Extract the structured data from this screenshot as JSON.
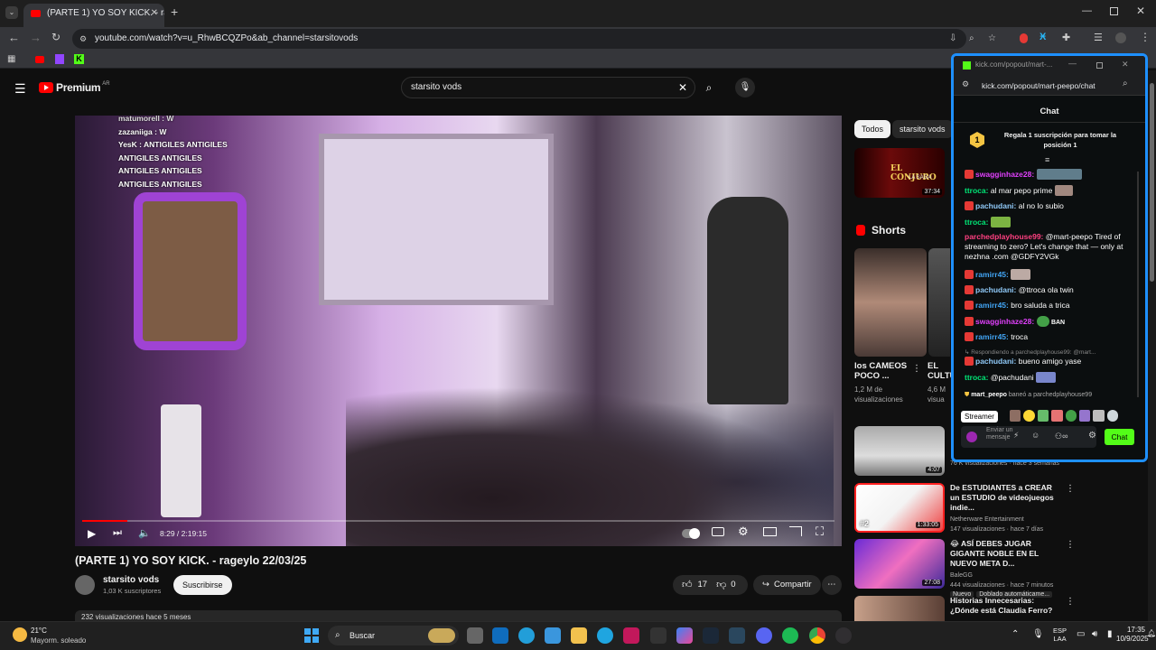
{
  "browser": {
    "tab_title": "(PARTE 1) YO SOY KICK. - rageyl",
    "url": "youtube.com/watch?v=u_RhwBCQZPo&ab_channel=starsitovods"
  },
  "yt": {
    "logo": "Premium",
    "region": "AR",
    "search": "starsito vods",
    "video_title": "(PARTE 1) YO SOY KICK. - rageylo 22/03/25",
    "channel": "starsito vods",
    "subs": "1,03 K suscriptores",
    "subscribe": "Suscribirse",
    "likes": "17",
    "dislikes": "0",
    "share": "Compartir",
    "views_partial": "232 visualizaciones hace 5 meses",
    "time": "8:29 / 2:19:15",
    "chips": [
      "Todos",
      "starsito vods"
    ],
    "shorts": "Shorts",
    "thumb_top_duration": "37:34",
    "thumb_top_label": "EL CONJURO",
    "thumb_top_sub": "LA SAGA"
  },
  "overlay_chat": [
    "matumorell : W",
    "zazaniiga : W",
    "YesK : ANTIGILES ANTIGILES",
    "ANTIGILES ANTIGILES",
    "ANTIGILES ANTIGILES",
    "ANTIGILES ANTIGILES"
  ],
  "shorts_items": [
    {
      "title": "los CAMEOS POCO ...",
      "meta1": "1,2 M de",
      "meta2": "visualizaciones"
    },
    {
      "title": "EL CULTU",
      "meta1": "4,6 M",
      "meta2": "visua"
    }
  ],
  "related": [
    {
      "duration": "4:07",
      "title": "",
      "channel": "",
      "meta": "76 K visualizaciones · hace 3 semanas"
    },
    {
      "duration": "1:33:05",
      "title": "De ESTUDIANTES a CREAR un ESTUDIO de videojuegos indie...",
      "channel": "Netherware Entertainment",
      "meta": "147 visualizaciones · hace 7 días",
      "badge": "#2"
    },
    {
      "duration": "27:08",
      "title": "😂 ASÍ DEBES JUGAR GIGANTE NOBLE EN EL NUEVO META D...",
      "channel": "BaleGG",
      "meta": "444 visualizaciones · hace 7 minutos",
      "extra1": "Nuevo",
      "extra2": "Doblado automáticame..."
    },
    {
      "duration": "",
      "title": "Historias Innecesarias: ¿Dónde está Claudia Ferro?",
      "channel": "",
      "meta": ""
    }
  ],
  "kick": {
    "title": "kick.com/popout/mart-...",
    "url": "kick.com/popout/mart-peepo/chat",
    "header": "Chat",
    "promo": "Regala 1 suscripción para tomar la posición 1",
    "promo_num": "1",
    "messages": [
      {
        "user": "swagginhaze28:",
        "color": "#e040fb",
        "text": ""
      },
      {
        "user": "ttroca:",
        "color": "#00e676",
        "text": "al mar pepo prime"
      },
      {
        "user": "pachudani:",
        "color": "#90caf9",
        "text": "al no lo subio"
      },
      {
        "user": "ttroca:",
        "color": "#00e676",
        "text": ""
      },
      {
        "user": "parchedplayhouse99:",
        "color": "#ff4081",
        "text": "@mart-peepo Tired of streaming to zero? Let's change that — only at nezhna .com @GDFY2VGk"
      },
      {
        "user": "ramirr45:",
        "color": "#42a5f5",
        "text": ""
      },
      {
        "user": "pachudani:",
        "color": "#90caf9",
        "text": "@ttroca ola twin"
      },
      {
        "user": "ramirr45:",
        "color": "#42a5f5",
        "text": "bro saluda a trica"
      },
      {
        "user": "swagginhaze28:",
        "color": "#e040fb",
        "text": "BAN"
      },
      {
        "user": "ramirr45:",
        "color": "#42a5f5",
        "text": "troca"
      },
      {
        "user": "",
        "color": "#888",
        "text": "Respondiendo a parchedplayhouse99: @mart..."
      },
      {
        "user": "pachudani:",
        "color": "#90caf9",
        "text": "bueno amigo yase"
      },
      {
        "user": "ttroca:",
        "color": "#00e676",
        "text": "@pachudani"
      },
      {
        "user": "mart_peepo",
        "color": "#fff",
        "text": "baneó a parchedplayhouse99"
      }
    ],
    "tooltip": "Streamer",
    "input": "Enviar un mensaje",
    "send": "Chat"
  },
  "taskbar": {
    "temp": "21°C",
    "weather": "Mayorm. soleado",
    "search": "Buscar",
    "lang1": "ESP",
    "lang2": "LAA",
    "time": "17:35",
    "date": "10/9/2025"
  }
}
